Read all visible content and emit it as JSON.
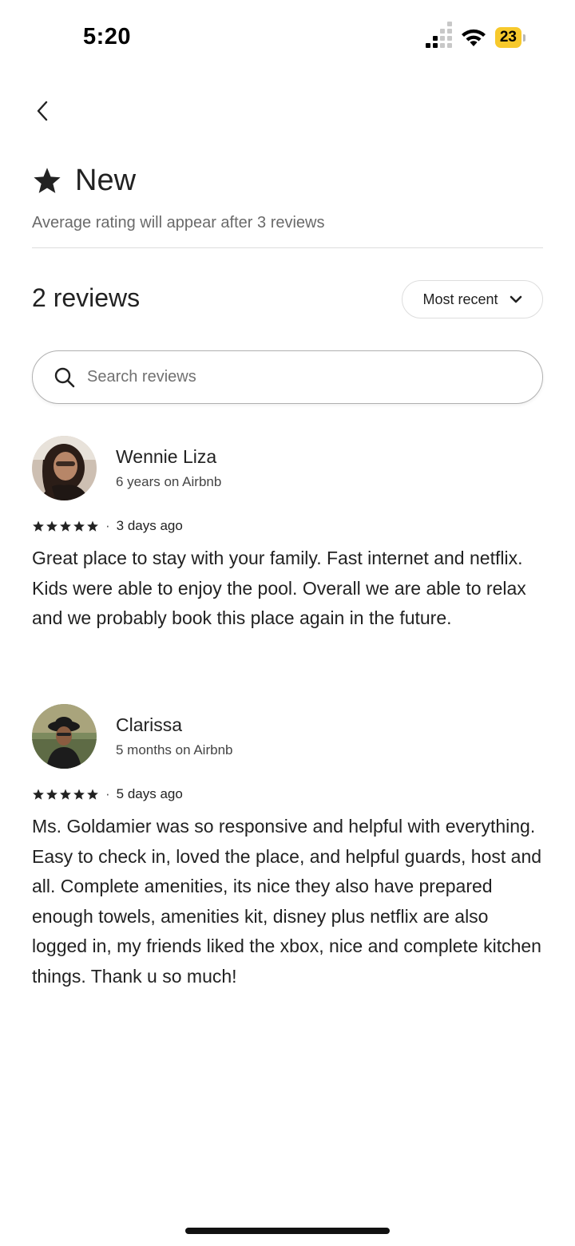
{
  "status_bar": {
    "time": "5:20",
    "battery": "23",
    "battery_color": "#f7c92c"
  },
  "header": {
    "back_icon": "chevron-left-icon",
    "rating_icon": "star-icon",
    "rating_label": "New",
    "rating_subtitle": "Average rating will appear after 3 reviews"
  },
  "reviews_section": {
    "count_label": "2 reviews",
    "sort": {
      "label": "Most recent",
      "icon": "chevron-down-icon"
    },
    "search": {
      "placeholder": "Search reviews",
      "value": ""
    }
  },
  "reviews": [
    {
      "name": "Wennie Liza",
      "tenure": "6 years on Airbnb",
      "stars": 5,
      "date": "3 days ago",
      "text": "Great place to stay with your family. Fast internet and netflix. Kids were able to enjoy the pool. Overall we are able to relax and we probably book this place again in the future."
    },
    {
      "name": "Clarissa",
      "tenure": "5 months on Airbnb",
      "stars": 5,
      "date": "5 days ago",
      "text": "Ms. Goldamier was so responsive and helpful with everything. Easy to check in, loved the place, and helpful guards, host and all. Complete amenities, its nice they also have prepared enough towels, amenities kit, disney plus netflix are also logged in, my friends liked the xbox, nice and complete kitchen things. Thank u so much!"
    }
  ]
}
